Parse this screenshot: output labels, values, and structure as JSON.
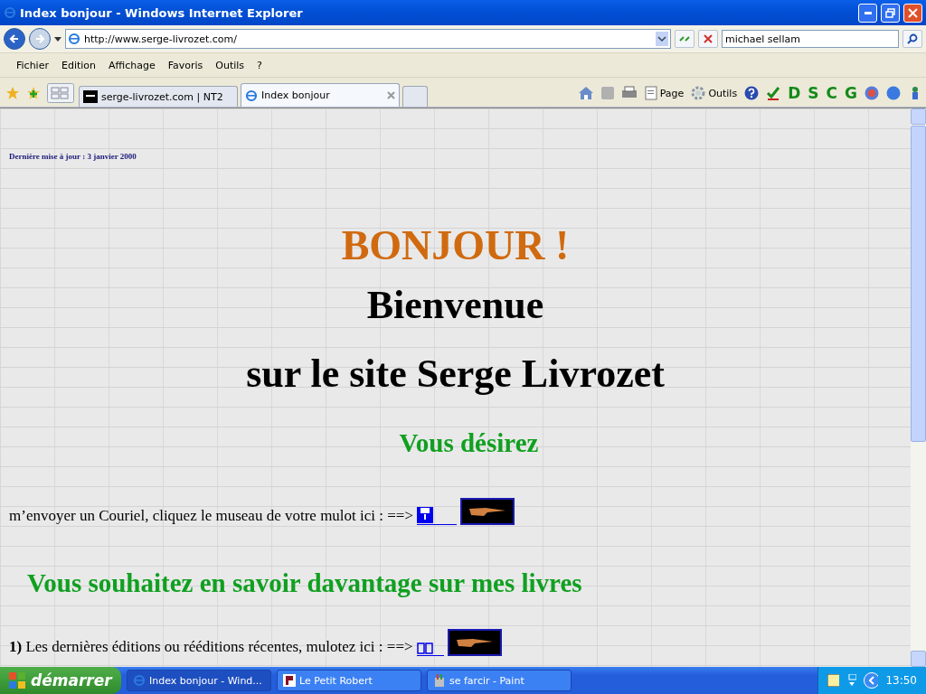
{
  "window": {
    "title": "Index bonjour - Windows Internet Explorer"
  },
  "address": {
    "url": "http://www.serge-livrozet.com/"
  },
  "search": {
    "value": "michael sellam"
  },
  "menu": [
    "Fichier",
    "Edition",
    "Affichage",
    "Favoris",
    "Outils",
    "?"
  ],
  "tabs": [
    {
      "label": "serge-livrozet.com | NT2",
      "kind": "nt2",
      "selected": false
    },
    {
      "label": "Index bonjour",
      "kind": "ie",
      "selected": true
    }
  ],
  "tools": [
    {
      "label": "Page",
      "kind": "page"
    },
    {
      "label": "Outils",
      "kind": "gear"
    }
  ],
  "letter_buttons": [
    "D",
    "S",
    "C",
    "G"
  ],
  "page": {
    "update_note": "Dernière mise à jour : 3 janvier 2000",
    "greeting": "BONJOUR !",
    "welcome": [
      "Bienvenue",
      "sur le site Serge Livrozet"
    ],
    "heading_1": "Vous désirez",
    "mail_line": "m’envoyer un Couriel, cliquez le museau de votre mulot ici : ==>",
    "heading_2": "Vous souhaitez en savoir davantage sur mes livres",
    "books_line": "**1)** Les dernières éditions ou rééditions récentes, mulotez ici : ==>"
  },
  "taskbar": {
    "start": "démarrer",
    "items": [
      {
        "label": "Index bonjour - Wind...",
        "kind": "ie",
        "selected": true
      },
      {
        "label": "Le Petit Robert",
        "kind": "robert",
        "selected": false
      },
      {
        "label": "se farcir - Paint",
        "kind": "paint",
        "selected": false
      }
    ],
    "clock": "13:50"
  }
}
